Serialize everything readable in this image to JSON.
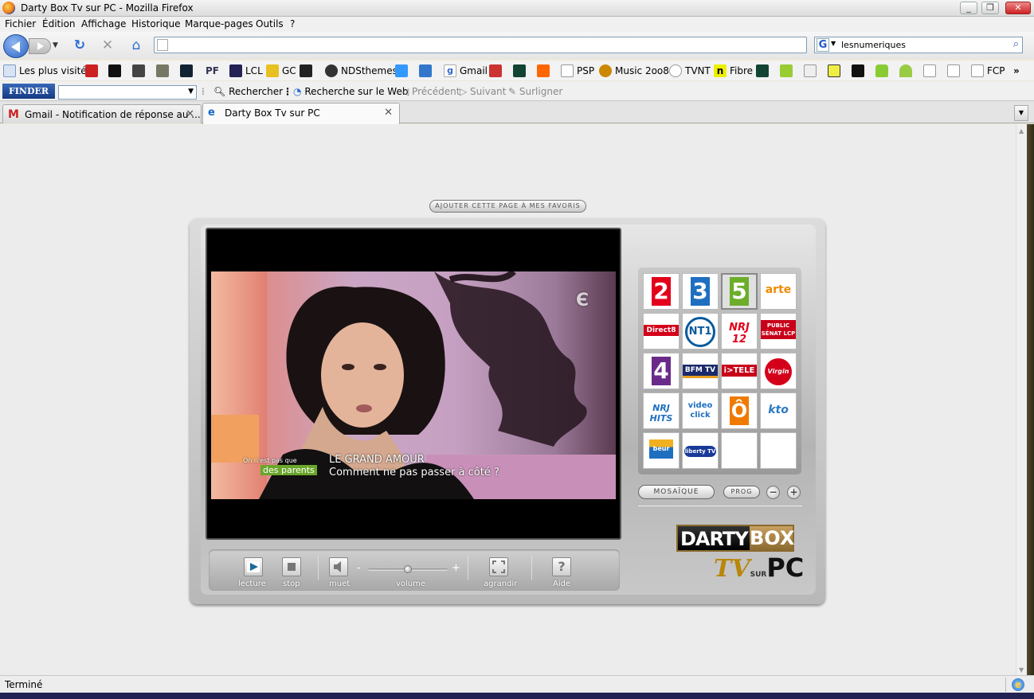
{
  "window": {
    "title": "Darty Box Tv sur PC - Mozilla Firefox"
  },
  "menu": [
    "Fichier",
    "Édition",
    "Affichage",
    "Historique",
    "Marque-pages",
    "Outils",
    "?"
  ],
  "urlbar": {
    "value": ""
  },
  "search": {
    "value": "lesnumeriques",
    "engine_icon": "google-icon"
  },
  "bookmarks": [
    "Les plus visités",
    "LCL",
    "GC",
    "NDSthemes",
    "Gmail",
    "PSP",
    "Music 2oo8",
    "TVNT",
    "Fibre",
    "FCP"
  ],
  "finder_toolbar": {
    "logo": "FINDER",
    "search": "Rechercher",
    "web": "Recherche sur le Web",
    "prev": "Précédent",
    "next": "Suivant",
    "highlight": "Surligner"
  },
  "tabs": [
    {
      "label": "Gmail - Notification de réponse au ...",
      "active": false
    },
    {
      "label": "Darty Box Tv sur PC",
      "active": true
    }
  ],
  "page": {
    "fav_button": "AJOUTER CETTE PAGE À MES FAVORIS",
    "subtitle_small": "On n'est pas que",
    "subtitle_tag": "des parents",
    "subtitle_line1": "LE GRAND AMOUR",
    "subtitle_line2": "Comment ne pas passer à côté ?",
    "controls": {
      "play": "lecture",
      "stop": "stop",
      "mute": "muet",
      "volume": "volume",
      "volume_level": 0.5,
      "fullscreen": "agrandir",
      "help": "Aide",
      "minus": "-",
      "plus": "+"
    },
    "channels": [
      {
        "name": "2",
        "color": "#e2001a"
      },
      {
        "name": "3",
        "color": "#1e6fc0"
      },
      {
        "name": "5",
        "color": "#6cae2a"
      },
      {
        "name": "arte",
        "color": "#f08a00"
      },
      {
        "name": "Direct8",
        "color": "#d4001a"
      },
      {
        "name": "NT1",
        "color": "#0a5a9c"
      },
      {
        "name": "NRJ 12",
        "color": "#e2001a"
      },
      {
        "name": "PUBLIC SÉNAT LCP",
        "color": "#c8001a"
      },
      {
        "name": "4",
        "color": "#6a2a8a"
      },
      {
        "name": "BFM TV",
        "color": "#1a2a6a"
      },
      {
        "name": "i>TELE",
        "color": "#c8001a"
      },
      {
        "name": "Virgin 17",
        "color": "#d4001a"
      },
      {
        "name": "NRJ HITS",
        "color": "#1e6fc0"
      },
      {
        "name": "video click",
        "color": "#1e6fc0"
      },
      {
        "name": "Ô",
        "color": "#f07a00"
      },
      {
        "name": "kto",
        "color": "#2a7ac0"
      },
      {
        "name": "beur TV",
        "color": "#1e6fc0"
      },
      {
        "name": "liberty TV",
        "color": "#1a3a9a"
      },
      {
        "name": "",
        "color": ""
      },
      {
        "name": "",
        "color": ""
      }
    ],
    "mosaique": "MOSAÏQUE",
    "prog": "PROG",
    "zoom_minus": "−",
    "zoom_plus": "+",
    "logo_darty": "DARTY",
    "logo_box": "BOX",
    "logo_tv": "TV",
    "logo_sur": "SUR",
    "logo_pc": "PC"
  },
  "status": {
    "text": "Terminé"
  }
}
